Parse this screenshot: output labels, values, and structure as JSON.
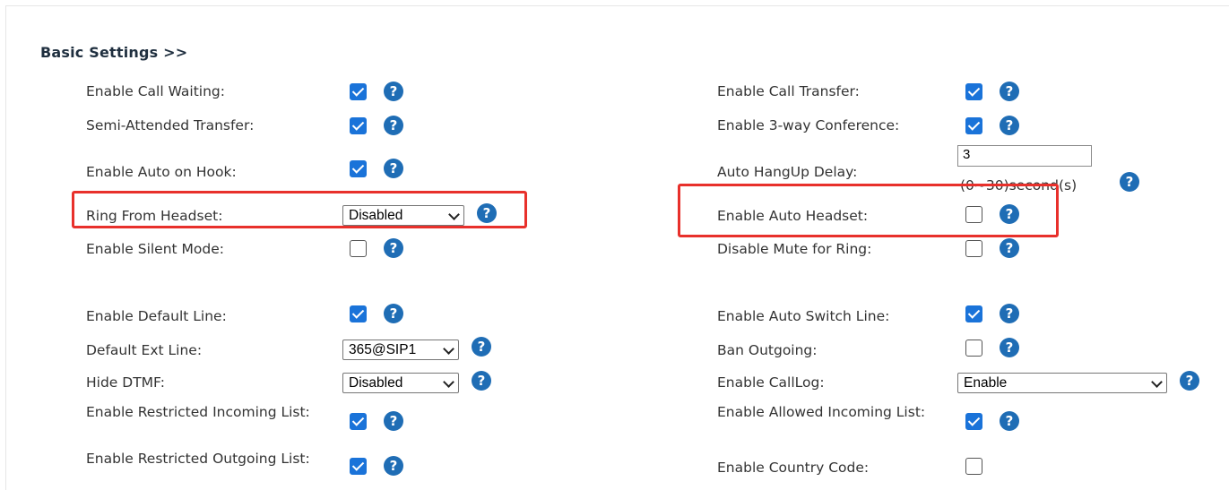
{
  "section": {
    "title": "Basic Settings >>"
  },
  "left": {
    "call_waiting": {
      "label": "Enable Call Waiting:",
      "checked": true
    },
    "semi_attended": {
      "label": "Semi-Attended Transfer:",
      "checked": true
    },
    "auto_on_hook": {
      "label": "Enable Auto on Hook:",
      "checked": true
    },
    "ring_from_headset": {
      "label": "Ring From Headset:",
      "value": "Disabled"
    },
    "silent_mode": {
      "label": "Enable Silent Mode:",
      "checked": false
    },
    "default_line": {
      "label": "Enable Default Line:",
      "checked": true
    },
    "default_ext_line": {
      "label": "Default Ext Line:",
      "value": "365@SIP1"
    },
    "hide_dtmf": {
      "label": "Hide DTMF:",
      "value": "Disabled"
    },
    "restricted_incoming": {
      "label": "Enable Restricted Incoming List:",
      "checked": true
    },
    "restricted_outgoing": {
      "label": "Enable Restricted Outgoing List:",
      "checked": true
    }
  },
  "right": {
    "call_transfer": {
      "label": "Enable Call Transfer:",
      "checked": true
    },
    "three_way_conf": {
      "label": "Enable 3-way Conference:",
      "checked": true
    },
    "auto_hangup_delay": {
      "label": "Auto HangUp Delay:",
      "value": "3",
      "unit": "(0~30)second(s)"
    },
    "auto_headset": {
      "label": "Enable Auto Headset:",
      "checked": false
    },
    "disable_mute_ring": {
      "label": "Disable Mute for Ring:",
      "checked": false
    },
    "auto_switch_line": {
      "label": "Enable Auto Switch Line:",
      "checked": true
    },
    "ban_outgoing": {
      "label": "Ban Outgoing:",
      "checked": false
    },
    "calllog": {
      "label": "Enable CallLog:",
      "value": "Enable"
    },
    "allowed_incoming": {
      "label": "Enable Allowed Incoming List:",
      "checked": true
    },
    "country_code": {
      "label": "Enable Country Code:",
      "checked": false
    }
  },
  "icons": {
    "help": "?"
  },
  "colors": {
    "checkbox": "#1a73d9",
    "help_icon": "#1f6db5",
    "highlight": "#e8302b",
    "heading": "#1f2f3f"
  }
}
